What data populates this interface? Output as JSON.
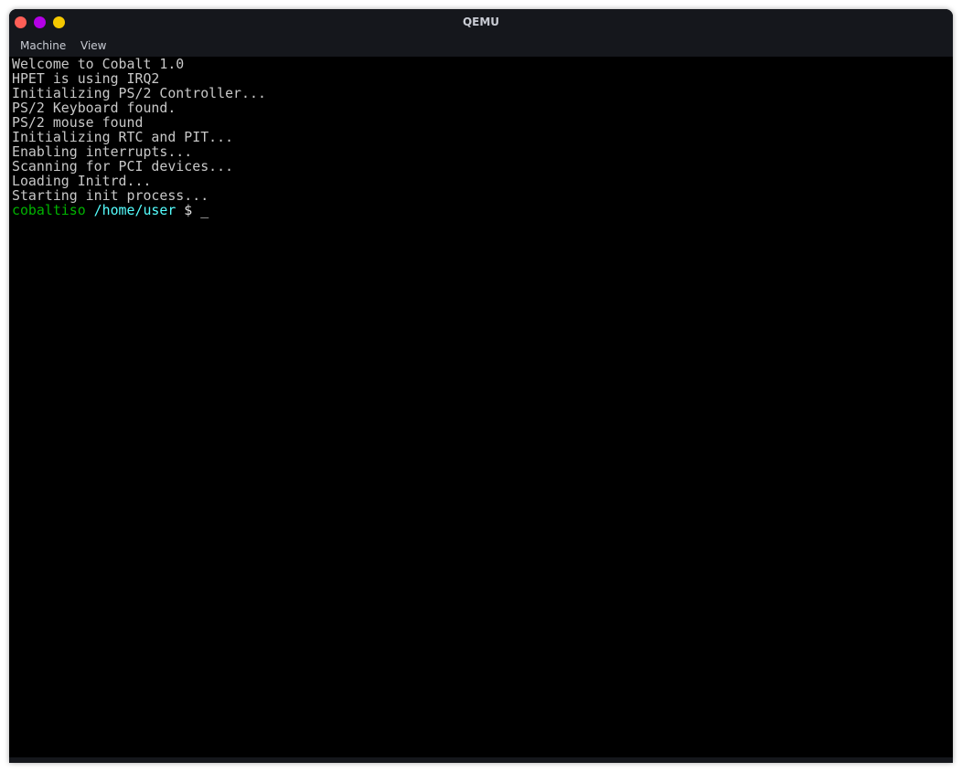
{
  "window": {
    "title": "QEMU",
    "buttons": [
      {
        "name": "close",
        "color": "#ff5f57"
      },
      {
        "name": "minimize",
        "color": "#b400e6"
      },
      {
        "name": "maximize",
        "color": "#f5c800"
      }
    ]
  },
  "menu": {
    "items": [
      "Machine",
      "View"
    ]
  },
  "terminal": {
    "lines": [
      "Welcome to Cobalt 1.0",
      "HPET is using IRQ2",
      "Initializing PS/2 Controller...",
      "PS/2 Keyboard found.",
      "PS/2 mouse found",
      "Initializing RTC and PIT...",
      "Enabling interrupts...",
      "Scanning for PCI devices...",
      "Loading Initrd...",
      "Starting init process..."
    ],
    "prompt": {
      "user": "cobaltiso",
      "path": "/home/user",
      "symbol": "$",
      "cursor": "_"
    },
    "colors": {
      "text": "#c8c8c8",
      "user": "#00b400",
      "path": "#55ffff",
      "background": "#000000"
    }
  }
}
